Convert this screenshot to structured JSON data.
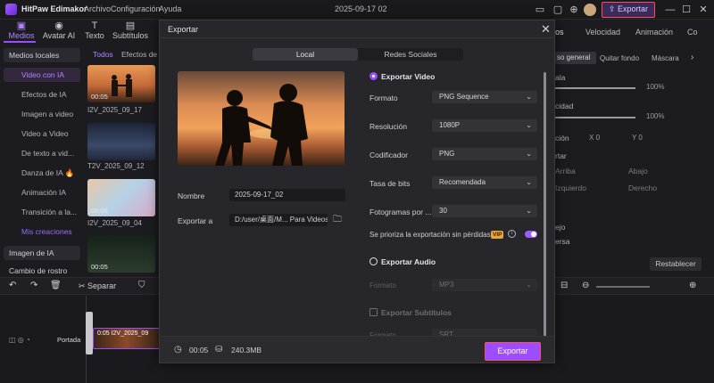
{
  "app": {
    "title": "HitPaw Edimakor",
    "menu": [
      "Archivo",
      "Configuración",
      "Ayuda"
    ],
    "doc_title": "2025-09-17 02",
    "export_label": "Exportar",
    "accent": "#9b4dff"
  },
  "top_tabs": [
    {
      "label": "Medios",
      "icon": "folder-icon"
    },
    {
      "label": "Avatar AI",
      "icon": "avatar-icon"
    },
    {
      "label": "Texto",
      "icon": "text-icon"
    },
    {
      "label": "Subtítulos",
      "icon": "subtitles-icon"
    }
  ],
  "sidebar": {
    "header": "Medios locales",
    "items": [
      {
        "label": "Video con IA",
        "selected": true
      },
      {
        "label": "Efectos de IA"
      },
      {
        "label": "Imagen a video"
      },
      {
        "label": "Video a Video"
      },
      {
        "label": "De texto a vid..."
      },
      {
        "label": "Danza de IA 🔥"
      },
      {
        "label": "Animación IA"
      },
      {
        "label": "Transición a la..."
      },
      {
        "label": "Mis creaciones",
        "purple": true
      }
    ],
    "footer_items": [
      "Imagen de IA",
      "Cambio de rostro"
    ]
  },
  "media": {
    "filters": [
      "Todos",
      "Efectos de"
    ],
    "clips": [
      {
        "duration": "00:05",
        "name": "I2V_2025_09_17"
      },
      {
        "duration": "",
        "name": "T2V_2025_09_12"
      },
      {
        "duration": "00:05",
        "name": "I2V_2025_09_04"
      },
      {
        "duration": "00:05",
        "name": ""
      }
    ]
  },
  "timeline": {
    "split_label": "Separar",
    "track_label": "Portada",
    "clip_label": "0:05 I2V_2025_09"
  },
  "right_panel": {
    "tabs": [
      "os",
      "Velocidad",
      "Animación",
      "Co"
    ],
    "subtabs": [
      "so general",
      "Quitar fondo",
      "Máscara"
    ],
    "fields": [
      "ala",
      "cidad",
      "ción",
      "rtar",
      "Arriba",
      "Abajo",
      "Izquierdo",
      "Derecho",
      "ejo",
      "ersa"
    ],
    "values": [
      "100%",
      "100%",
      "0",
      "0",
      "0",
      "0"
    ],
    "reset": "Restablecer"
  },
  "modal": {
    "title": "Exportar",
    "tabs": [
      "Local",
      "Redes Sociales"
    ],
    "name_label": "Nombre",
    "name_value": "2025-09-17_02",
    "export_to_label": "Exportar a",
    "export_to_value": "D:/user/桌面/M... Para Videos",
    "video_section": "Exportar Video",
    "rows": [
      {
        "label": "Formato",
        "value": "PNG Sequence"
      },
      {
        "label": "Resolución",
        "value": "1080P"
      },
      {
        "label": "Codificador",
        "value": "PNG"
      },
      {
        "label": "Tasa de bits",
        "value": "Recomendada"
      },
      {
        "label": "Fotogramas por ...",
        "value": "30"
      }
    ],
    "lossless_label": "Se prioriza la exportación sin pérdidas",
    "vip_label": "VIP",
    "audio_section": "Exportar Audio",
    "audio_format_label": "Formato",
    "audio_format_value": "MP3",
    "subtitles_section": "Exportar Subtítulos",
    "sub_format_label": "Formato",
    "sub_format_value": "SRT",
    "duration": "00:05",
    "size": "240.3MB",
    "export_button": "Exportar"
  }
}
